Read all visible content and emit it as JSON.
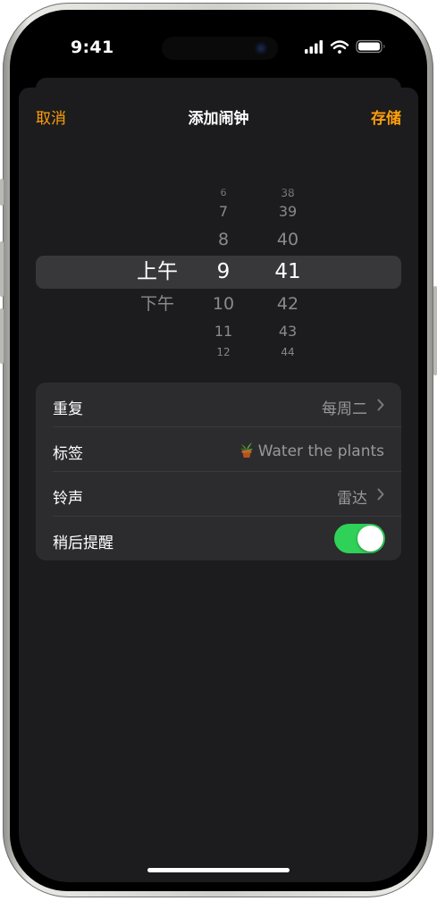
{
  "status_bar": {
    "time": "9:41",
    "icons": [
      "signal-icon",
      "wifi-icon",
      "battery-icon"
    ]
  },
  "nav": {
    "cancel_label": "取消",
    "title": "添加闹钟",
    "save_label": "存储"
  },
  "picker": {
    "ampm": {
      "options": [
        "上午",
        "下午"
      ],
      "selected": "上午"
    },
    "hours": {
      "visible": [
        "6",
        "7",
        "8",
        "9",
        "10",
        "11",
        "12"
      ],
      "selected": "9"
    },
    "minutes": {
      "visible": [
        "38",
        "39",
        "40",
        "41",
        "42",
        "43",
        "44"
      ],
      "selected": "41"
    }
  },
  "settings": {
    "repeat": {
      "label": "重复",
      "value": "每周二"
    },
    "tag": {
      "label": "标签",
      "value": "Water the plants",
      "icon": "potted-plant-icon"
    },
    "sound": {
      "label": "铃声",
      "value": "雷达"
    },
    "snooze": {
      "label": "稍后提醒",
      "enabled": true
    }
  },
  "colors": {
    "accent": "#ff9f0a",
    "toggle_on": "#30d158",
    "sheet_background": "#1c1c1e",
    "group_background": "#2c2c2e",
    "secondary_text": "#98989d"
  }
}
